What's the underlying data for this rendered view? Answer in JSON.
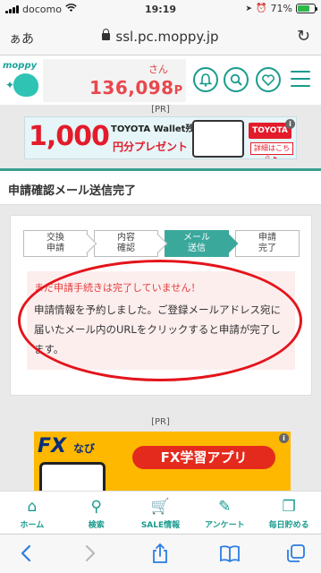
{
  "status_bar": {
    "carrier": "docomo",
    "time": "19:19",
    "battery": "71%"
  },
  "browser": {
    "aa_label": "ぁあ",
    "url": "ssl.pc.moppy.jp"
  },
  "header": {
    "logo_text": "moppy",
    "user_suffix": "さん",
    "points_value": "136,098",
    "points_unit": "P"
  },
  "pr_label": "[PR]",
  "banner_top": {
    "amount": "1,000",
    "subtitle": "円分プレゼント",
    "brand_line": "TOYOTA Wallet残高",
    "logo_text": "TOYOTA wallet",
    "detail_button": "詳細はこちら ▶",
    "info": "i"
  },
  "page_title": "申請確認メール送信完了",
  "steps": [
    {
      "line1": "交換",
      "line2": "申請"
    },
    {
      "line1": "内容",
      "line2": "確認"
    },
    {
      "line1": "メール",
      "line2": "送信"
    },
    {
      "line1": "申請",
      "line2": "完了"
    }
  ],
  "notice": {
    "warning": "まだ申請手続きは完了していません！",
    "body": "申請情報を予約しました。ご登録メールアドレス宛に届いたメール内のURLをクリックすると申請が完了します。"
  },
  "banner_bottom": {
    "fx": "FX",
    "navi": "なび",
    "app_label": "FX学習アプリ",
    "info": "i"
  },
  "bottom_nav": [
    {
      "label": "ホーム",
      "icon": "⌂"
    },
    {
      "label": "検索",
      "icon": "⚲"
    },
    {
      "label": "SALE情報",
      "icon": "🛒"
    },
    {
      "label": "アンケート",
      "icon": "✎"
    },
    {
      "label": "毎日貯める",
      "icon": "❐"
    }
  ],
  "colors": {
    "accent": "#1a9b8e",
    "points_red": "#e8484d",
    "warning_red": "#e53a3a",
    "active_step": "#3ba89c"
  }
}
